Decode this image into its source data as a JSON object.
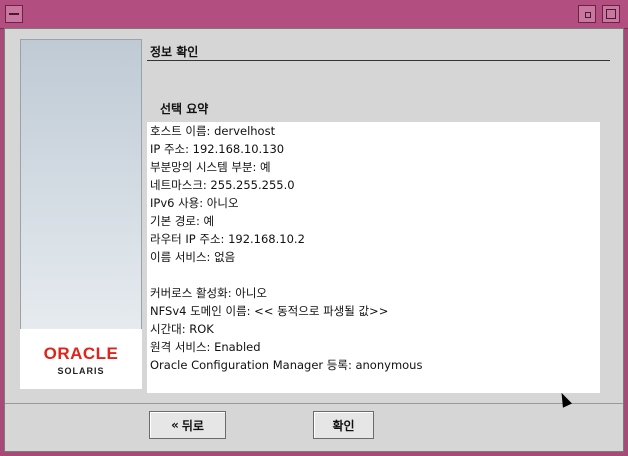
{
  "section": {
    "title": "정보 확인",
    "subtitle": "선택 요약"
  },
  "brand": {
    "oracle": "ORACLE",
    "product": "SOLARIS",
    "accent": "#e2231a"
  },
  "summary": [
    "호스트 이름: dervelhost",
    "IP 주소: 192.168.10.130",
    "부분망의 시스템 부분: 예",
    "네트마스크: 255.255.255.0",
    "IPv6 사용: 아니오",
    "기본 경로: 예",
    "라우터 IP 주소: 192.168.10.2",
    "이름 서비스: 없음",
    "",
    "커버로스 활성화: 아니오",
    "NFSv4 도메인 이름: << 동적으로 파생될 값>>",
    "시간대: ROK",
    "원격 서비스: Enabled",
    "Oracle Configuration Manager 등록: anonymous"
  ],
  "buttons": {
    "back": "뒤로",
    "ok": "확인"
  },
  "icons": {
    "back": "double-chevron-left-icon"
  }
}
